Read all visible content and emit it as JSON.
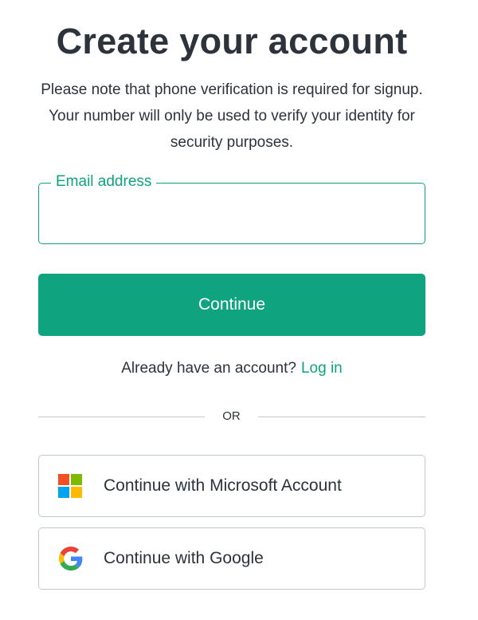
{
  "header": {
    "title": "Create your account",
    "subtitle": "Please note that phone verification is required for signup. Your number will only be used to verify your identity for security purposes."
  },
  "form": {
    "email_label": "Email address",
    "email_value": "",
    "continue_label": "Continue"
  },
  "login_prompt": {
    "text": "Already have an account?",
    "link_label": "Log in"
  },
  "divider": {
    "label": "OR"
  },
  "social": [
    {
      "label": "Continue with Microsoft Account",
      "icon": "microsoft-logo-icon",
      "colors": [
        "#f25022",
        "#7fba00",
        "#00a4ef",
        "#ffb900"
      ]
    },
    {
      "label": "Continue with Google",
      "icon": "google-logo-icon",
      "colors": [
        "#4285f4",
        "#34a853",
        "#fbbc05",
        "#ea4335"
      ]
    }
  ],
  "theme": {
    "accent": "#10a37f",
    "text": "#2d333a",
    "border": "#c2c8d0"
  }
}
